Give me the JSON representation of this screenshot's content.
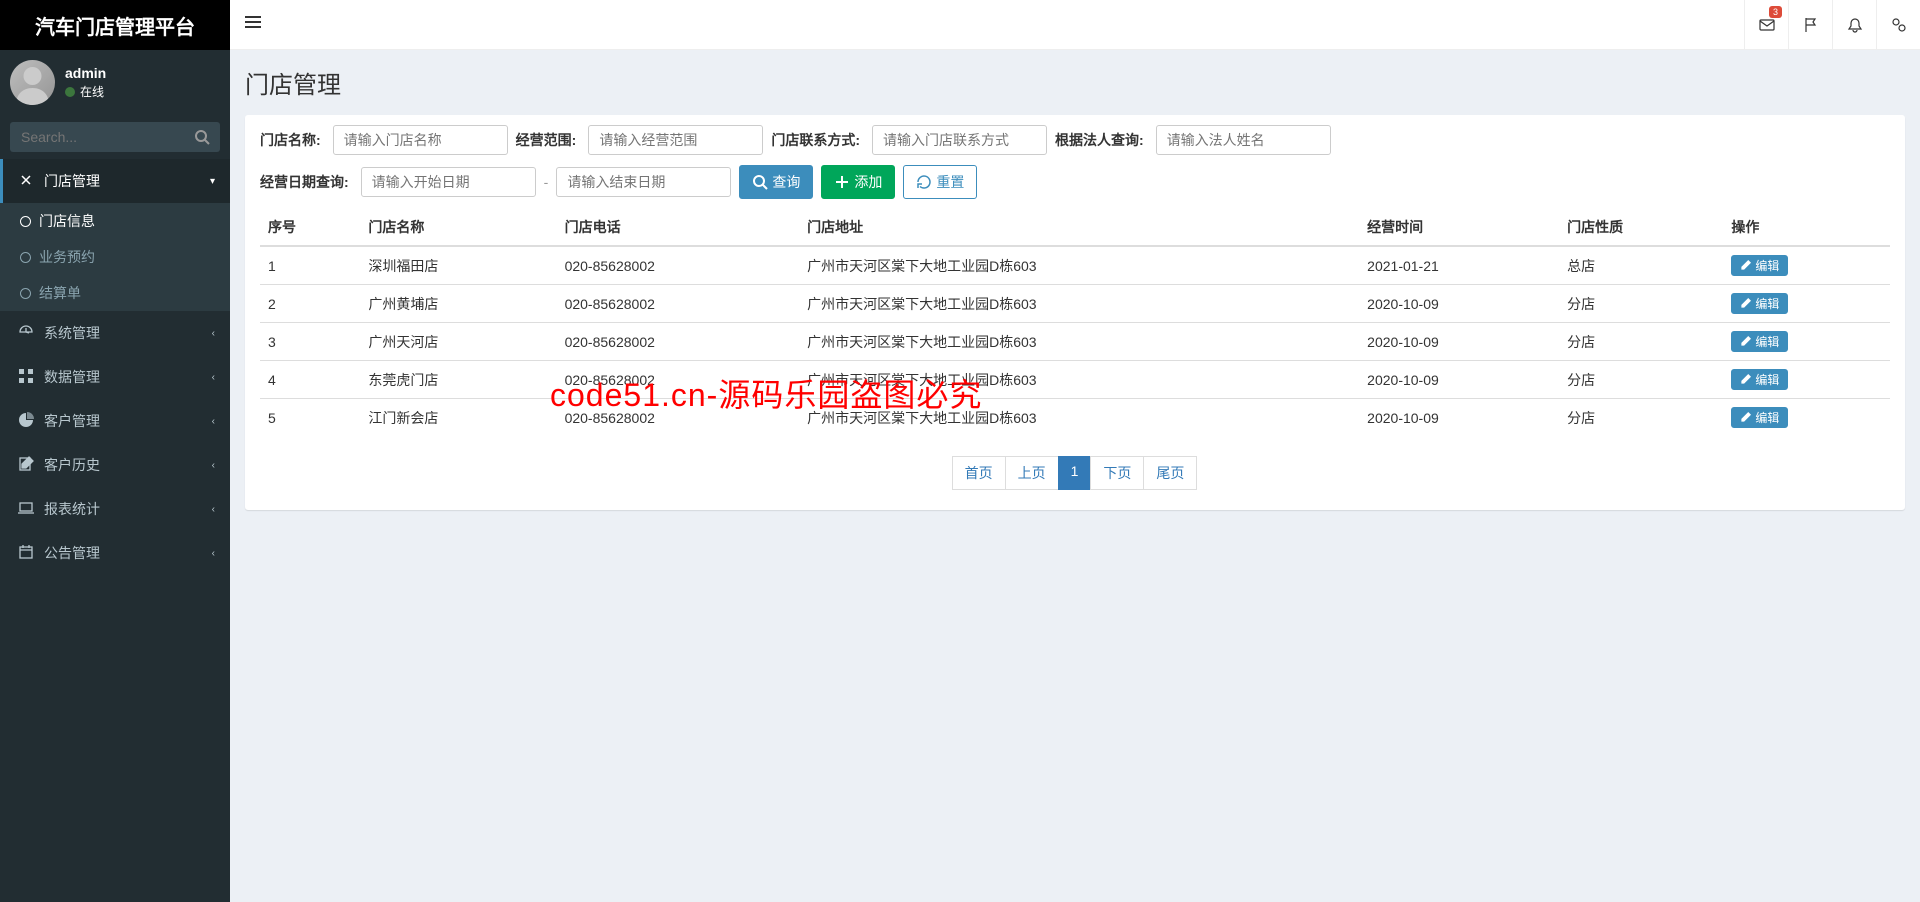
{
  "app": {
    "title": "汽车门店管理平台"
  },
  "user": {
    "name": "admin",
    "status": "在线"
  },
  "search": {
    "placeholder": "Search..."
  },
  "topbar": {
    "envelope_badge": "3"
  },
  "nav": {
    "items": [
      {
        "label": "门店管理",
        "icon": "joomla-icon",
        "open": true,
        "children": [
          {
            "label": "门店信息",
            "active": true
          },
          {
            "label": "业务预约"
          },
          {
            "label": "结算单"
          }
        ]
      },
      {
        "label": "系统管理",
        "icon": "dashboard-icon"
      },
      {
        "label": "数据管理",
        "icon": "grid-icon"
      },
      {
        "label": "客户管理",
        "icon": "pie-icon"
      },
      {
        "label": "客户历史",
        "icon": "edit-icon"
      },
      {
        "label": "报表统计",
        "icon": "laptop-icon"
      },
      {
        "label": "公告管理",
        "icon": "calendar-icon"
      }
    ]
  },
  "page": {
    "title": "门店管理"
  },
  "filters": {
    "name_label": "门店名称:",
    "name_ph": "请输入门店名称",
    "scope_label": "经营范围:",
    "scope_ph": "请输入经营范围",
    "contact_label": "门店联系方式:",
    "contact_ph": "请输入门店联系方式",
    "legal_label": "根据法人查询:",
    "legal_ph": "请输入法人姓名",
    "daterange_label": "经营日期查询:",
    "start_ph": "请输入开始日期",
    "end_ph": "请输入结束日期",
    "query_btn": "查询",
    "add_btn": "添加",
    "reset_btn": "重置"
  },
  "table": {
    "headers": [
      "序号",
      "门店名称",
      "门店电话",
      "门店地址",
      "经营时间",
      "门店性质",
      "操作"
    ],
    "edit_label": "编辑",
    "rows": [
      {
        "no": "1",
        "name": "深圳福田店",
        "phone": "020-85628002",
        "address": "广州市天河区棠下大地工业园D栋603",
        "date": "2021-01-21",
        "type": "总店"
      },
      {
        "no": "2",
        "name": "广州黄埔店",
        "phone": "020-85628002",
        "address": "广州市天河区棠下大地工业园D栋603",
        "date": "2020-10-09",
        "type": "分店"
      },
      {
        "no": "3",
        "name": "广州天河店",
        "phone": "020-85628002",
        "address": "广州市天河区棠下大地工业园D栋603",
        "date": "2020-10-09",
        "type": "分店"
      },
      {
        "no": "4",
        "name": "东莞虎门店",
        "phone": "020-85628002",
        "address": "广州市天河区棠下大地工业园D栋603",
        "date": "2020-10-09",
        "type": "分店"
      },
      {
        "no": "5",
        "name": "江门新会店",
        "phone": "020-85628002",
        "address": "广州市天河区棠下大地工业园D栋603",
        "date": "2020-10-09",
        "type": "分店"
      }
    ]
  },
  "pagination": {
    "first": "首页",
    "prev": "上页",
    "current": "1",
    "next": "下页",
    "last": "尾页"
  },
  "watermark": "code51.cn-源码乐园盗图必究"
}
